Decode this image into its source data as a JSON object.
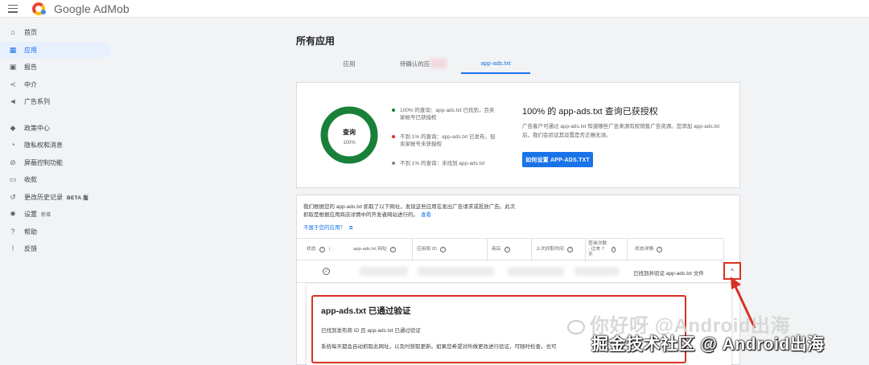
{
  "app": {
    "brand": "Google AdMob"
  },
  "sidebar": {
    "items": [
      {
        "label": "首页",
        "icon": "home-icon",
        "glyph": "⌂"
      },
      {
        "label": "应用",
        "icon": "apps-icon",
        "glyph": "▦",
        "active": true
      },
      {
        "label": "报告",
        "icon": "reports-icon",
        "glyph": "▣"
      },
      {
        "label": "中介",
        "icon": "mediation-icon",
        "glyph": "≺"
      },
      {
        "label": "广告系列",
        "icon": "campaigns-icon",
        "glyph": "◄"
      },
      {
        "label": "政策中心",
        "icon": "policy-shield-icon",
        "glyph": "◆"
      },
      {
        "label": "隐私权和消息",
        "icon": "privacy-icon",
        "glyph": "◔"
      },
      {
        "label": "屏蔽控制功能",
        "icon": "block-icon",
        "glyph": "⊘"
      },
      {
        "label": "收款",
        "icon": "payments-icon",
        "glyph": "▭"
      },
      {
        "label": "更改历史记录",
        "icon": "history-icon",
        "glyph": "↺",
        "tag": "BETA 版"
      },
      {
        "label": "设置",
        "icon": "settings-gear-icon",
        "glyph": "✹",
        "tag": "新增"
      },
      {
        "label": "帮助",
        "icon": "help-icon",
        "glyph": "?"
      },
      {
        "label": "反馈",
        "icon": "feedback-icon",
        "glyph": "!"
      }
    ]
  },
  "main": {
    "title": "所有应用",
    "tabs": [
      {
        "label": "应用"
      },
      {
        "label": "待确认的应"
      },
      {
        "label": "app-ads.txt",
        "active": true
      }
    ]
  },
  "summary": {
    "donut_label": "查询",
    "donut_sub": "100%",
    "donut_fill": 1.0,
    "legend": [
      {
        "text": "100% 的查询：app-ads.txt 已找到，且卖家帐号已获授权",
        "color": "#188038"
      },
      {
        "text": "不到 1% 的查询：app-ads.txt 已发布，但卖家帐号未获授权",
        "color": "#d93025"
      },
      {
        "text": "不到 1% 的查询：未找到 app-ads.txt",
        "color": "#80868b"
      }
    ],
    "title": "100% 的 app-ads.txt 查询已获授权",
    "desc": "广告客户可通过 app-ads.txt 知道哪些广告来源有权销售广告资源。您添加 app-ads.txt 后，我们会验证其设置是否正确无误。",
    "button": "如何设置 APP-ADS.TXT"
  },
  "crawl": {
    "text": "我们根据您的 app-ads.txt 抓取了以下网址，发现这些应用在发出广告请求或投放广告。此次抓取是根据应用商店详情中的开发者网站进行的。",
    "see": "查看",
    "link": "不属于您的应用？"
  },
  "table": {
    "headers": [
      {
        "label": "状态",
        "sort": "↑"
      },
      {
        "label": "app-ads.txt 网址"
      },
      {
        "label": "应用和 ID"
      },
      {
        "label": "商店"
      },
      {
        "label": "上次抓取时间"
      },
      {
        "label": "查询次数 - 过去 7 天"
      },
      {
        "label": "状态详情"
      }
    ],
    "row": {
      "status_icon": "✓",
      "detail": "已找到并验证 app-ads.txt 文件",
      "expand": "^"
    }
  },
  "verification": {
    "title": "app-ads.txt 已通过验证",
    "line1": "已找到发布商 ID 且 app-ads.txt 已通过验证",
    "line2": "系统每天都会自动抓取此网址，以及时获取更新。如果您希望对所做更改进行验证，可随时检查，也可"
  },
  "watermark": {
    "line1": "你好呀 @Android出海",
    "line2": "掘金技术社区 @ Android出海"
  },
  "colors": {
    "accent": "#1a73e8",
    "success": "#188038",
    "error": "#d93025",
    "annotation": "#d93025"
  }
}
